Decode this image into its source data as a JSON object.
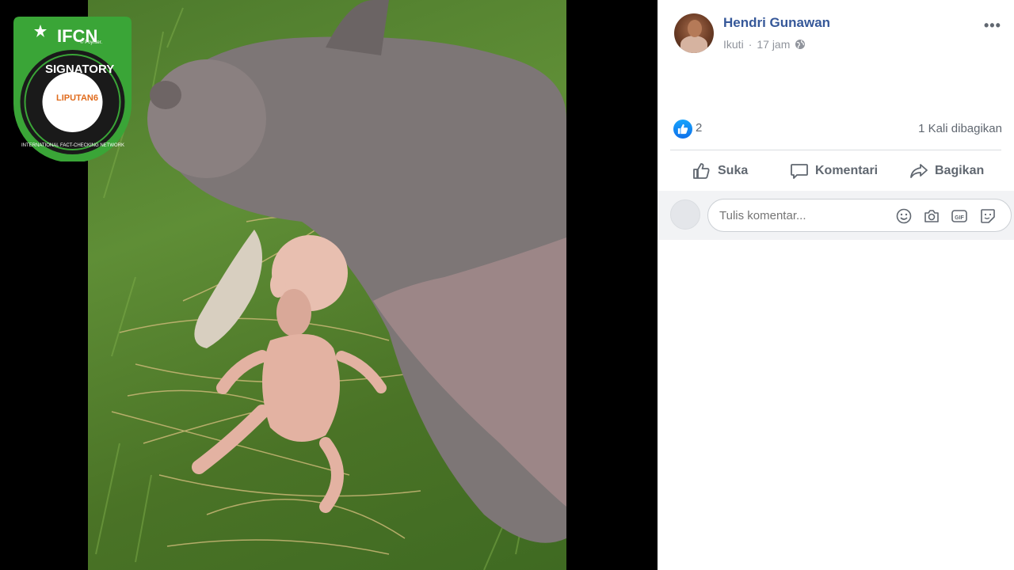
{
  "badge": {
    "title": "IFCN",
    "partner": "© Poynter.",
    "signatory": "SIGNATORY",
    "org": "LIPUTAN6",
    "network": "INTERNATIONAL FACT-CHECKING NETWORK"
  },
  "post": {
    "author": "Hendri Gunawan",
    "follow": "Ikuti",
    "time": "17 jam",
    "privacy_icon": "globe-icon",
    "reactions_count": "2",
    "shares": "1 Kali dibagikan"
  },
  "actions": {
    "like": "Suka",
    "comment": "Komentari",
    "share": "Bagikan"
  },
  "comment": {
    "placeholder": "Tulis komentar...",
    "icons": [
      "emoji-icon",
      "camera-icon",
      "gif-icon",
      "sticker-icon"
    ]
  },
  "colors": {
    "author_blue": "#365899",
    "like_blue": "#1877f2",
    "ifcn_green": "#3aa537",
    "meta_gray": "#90949c"
  }
}
